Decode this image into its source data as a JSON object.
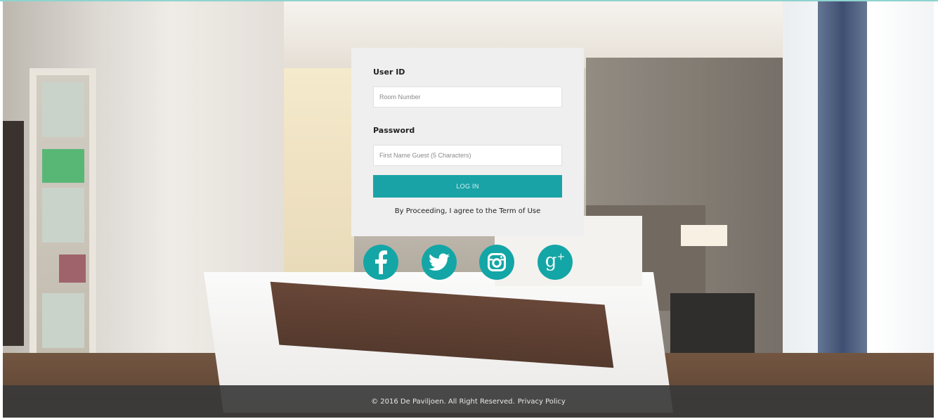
{
  "login": {
    "user_label": "User ID",
    "user_placeholder": "Room Number",
    "password_label": "Password",
    "password_placeholder": "First Name Guest (5 Characters)",
    "button_label": "LOG IN",
    "terms_text": "By Proceeding, I agree to the Term of Use"
  },
  "social": {
    "facebook_icon": "facebook-icon",
    "twitter_icon": "twitter-icon",
    "instagram_icon": "instagram-icon",
    "googleplus_icon": "google-plus-icon",
    "googleplus_glyph": "g",
    "googleplus_sup": "+"
  },
  "footer": {
    "copyright": "© 2016 De Paviljoen. All Right Reserved.",
    "privacy_link": "Privacy Policy"
  },
  "colors": {
    "accent": "#1aa3a6",
    "card": "#efefef",
    "footer": "#3a3a3a"
  }
}
